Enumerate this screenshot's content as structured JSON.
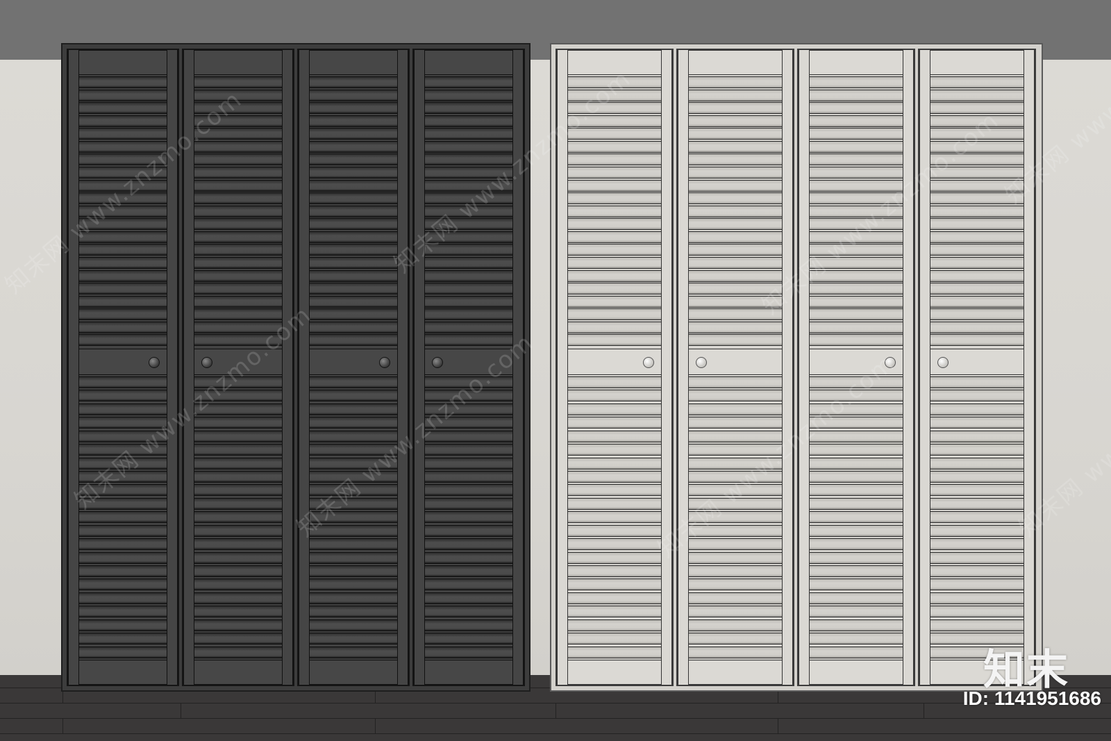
{
  "scene": {
    "subject": "louvered wardrobe doors",
    "colors": {
      "ceiling": "#727272",
      "wall": "#d8d6d1",
      "floor": "#3a3838",
      "dark_finish": "#424242",
      "light_finish": "#d7d5d0"
    }
  },
  "wardrobes": [
    {
      "finish": "dark",
      "door_count": 4,
      "louvers_per_door": 42,
      "knob_sides": [
        "right",
        "left",
        "right",
        "left"
      ]
    },
    {
      "finish": "light",
      "door_count": 4,
      "louvers_per_door": 42,
      "knob_sides": [
        "right",
        "left",
        "right",
        "left"
      ]
    }
  ],
  "watermark": {
    "text": "知末网 www.znzmo.com",
    "logo": "知末",
    "id_label": "ID: 1141951686"
  }
}
